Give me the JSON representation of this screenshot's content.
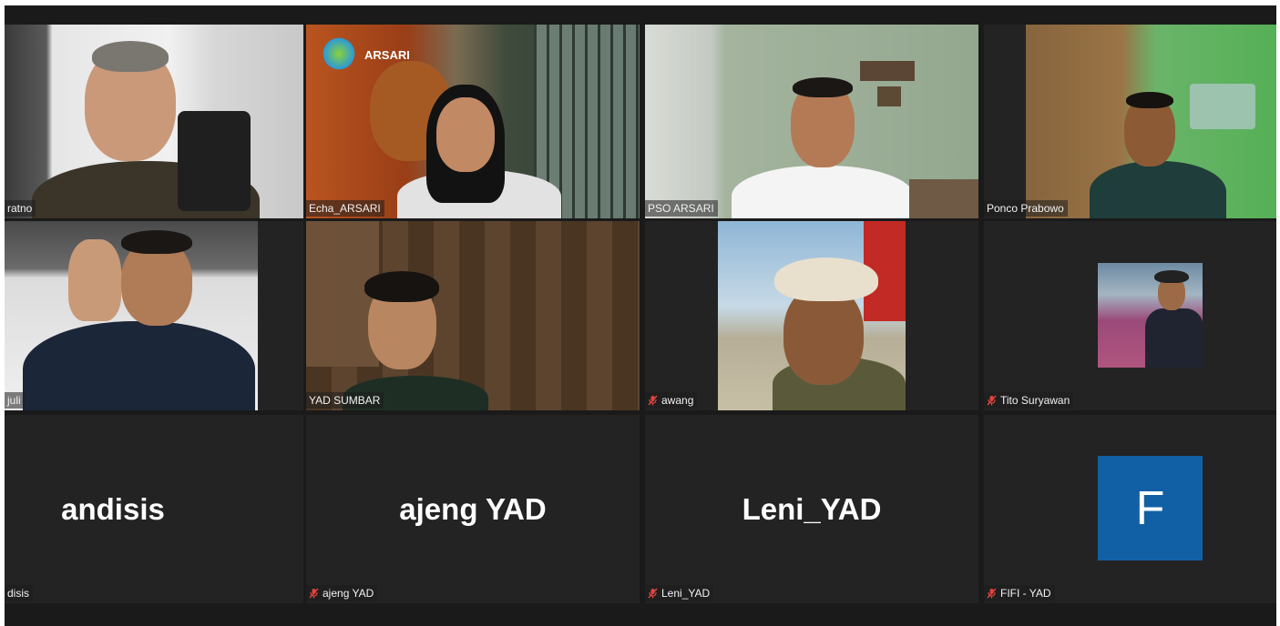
{
  "participants": [
    {
      "name": "ratno",
      "muted": false,
      "video": true,
      "speaking": true
    },
    {
      "name": "Echa_ARSARI",
      "muted": false,
      "video": true
    },
    {
      "name": "PSO ARSARI",
      "muted": false,
      "video": true
    },
    {
      "name": "Ponco Prabowo",
      "muted": false,
      "video": true
    },
    {
      "name": "juli",
      "muted": false,
      "video": true
    },
    {
      "name": "YAD SUMBAR",
      "muted": false,
      "video": true
    },
    {
      "name": "awang",
      "muted": true,
      "video": true
    },
    {
      "name": "Tito Suryawan",
      "muted": true,
      "video": true
    },
    {
      "name": "andisis",
      "display_name": "andisis",
      "tag": "disis",
      "muted": false,
      "video": false
    },
    {
      "name": "ajeng YAD",
      "display_name": "ajeng YAD",
      "muted": true,
      "video": false
    },
    {
      "name": "Leni_YAD",
      "display_name": "Leni_YAD",
      "muted": true,
      "video": false
    },
    {
      "name": "FIFI - YAD",
      "avatar_letter": "F",
      "muted": true,
      "video": false
    }
  ],
  "background_logo_text": "ARSARI",
  "colors": {
    "active_border": "#e4f05a",
    "tile_bg": "#232323",
    "avatar_bg": "#1160a6",
    "muted_icon": "#e0443e"
  },
  "icons": {
    "muted": "mic-off-icon"
  }
}
